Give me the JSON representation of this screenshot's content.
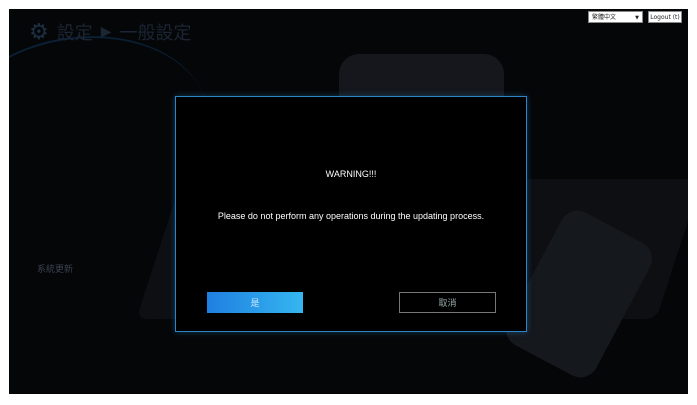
{
  "header": {
    "title": "設定",
    "separator": "▶",
    "subtitle": "一般設定"
  },
  "sidebar": {
    "current_item": "系統更新"
  },
  "top_controls": {
    "language": "繁體中文",
    "logout": "Logout (t)"
  },
  "dialog": {
    "title": "WARNING!!!",
    "message": "Please do not perform any operations during the updating process.",
    "confirm_label": "是",
    "cancel_label": "取消"
  },
  "colors": {
    "dialog_border": "#2a86c8",
    "confirm_button": "#1f7fe0",
    "background": "#050608"
  }
}
